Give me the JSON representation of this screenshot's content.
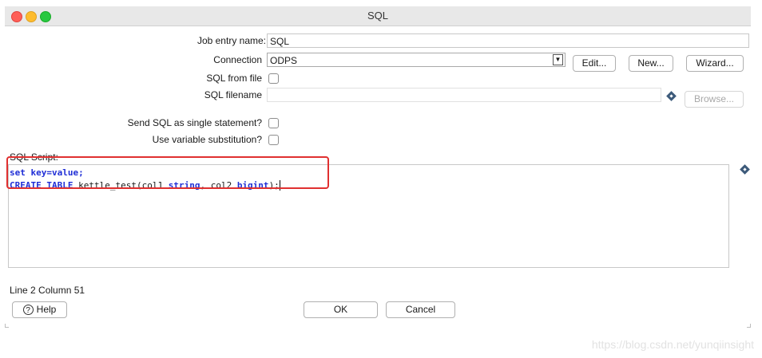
{
  "window": {
    "title": "SQL"
  },
  "fields": {
    "job_entry_name": {
      "label": "Job entry name:",
      "value": "SQL"
    },
    "connection": {
      "label": "Connection",
      "value": "ODPS"
    },
    "sql_from_file": {
      "label": "SQL from file"
    },
    "sql_filename": {
      "label": "SQL filename",
      "value": ""
    },
    "send_single": {
      "label": "Send SQL as single statement?"
    },
    "use_variable": {
      "label": "Use variable substitution?"
    },
    "sql_script": {
      "label": "SQL Script:"
    }
  },
  "buttons": {
    "edit": "Edit...",
    "new": "New...",
    "wizard": "Wizard...",
    "browse": "Browse...",
    "help": "Help",
    "ok": "OK",
    "cancel": "Cancel"
  },
  "code": {
    "line1": {
      "kw": "set",
      "rest": " key=value;"
    },
    "line2": {
      "kw1": "CREATE TABLE",
      "text1": " kettle_test(col1 ",
      "kw2": "string",
      "text2": ", col2 ",
      "kw3": "bigint",
      "text3": ");"
    }
  },
  "status": {
    "position": "Line 2 Column 51"
  },
  "watermark": "https://blog.csdn.net/yunqiinsight",
  "colors": {
    "keyword": "#1f2ed6",
    "highlight_border": "#e03030",
    "close": "#fe5f57",
    "minimize": "#febc2e",
    "maximize": "#28c840"
  },
  "icons": [
    "variable-diamond-icon",
    "help-icon",
    "dropdown-arrow-icon"
  ]
}
